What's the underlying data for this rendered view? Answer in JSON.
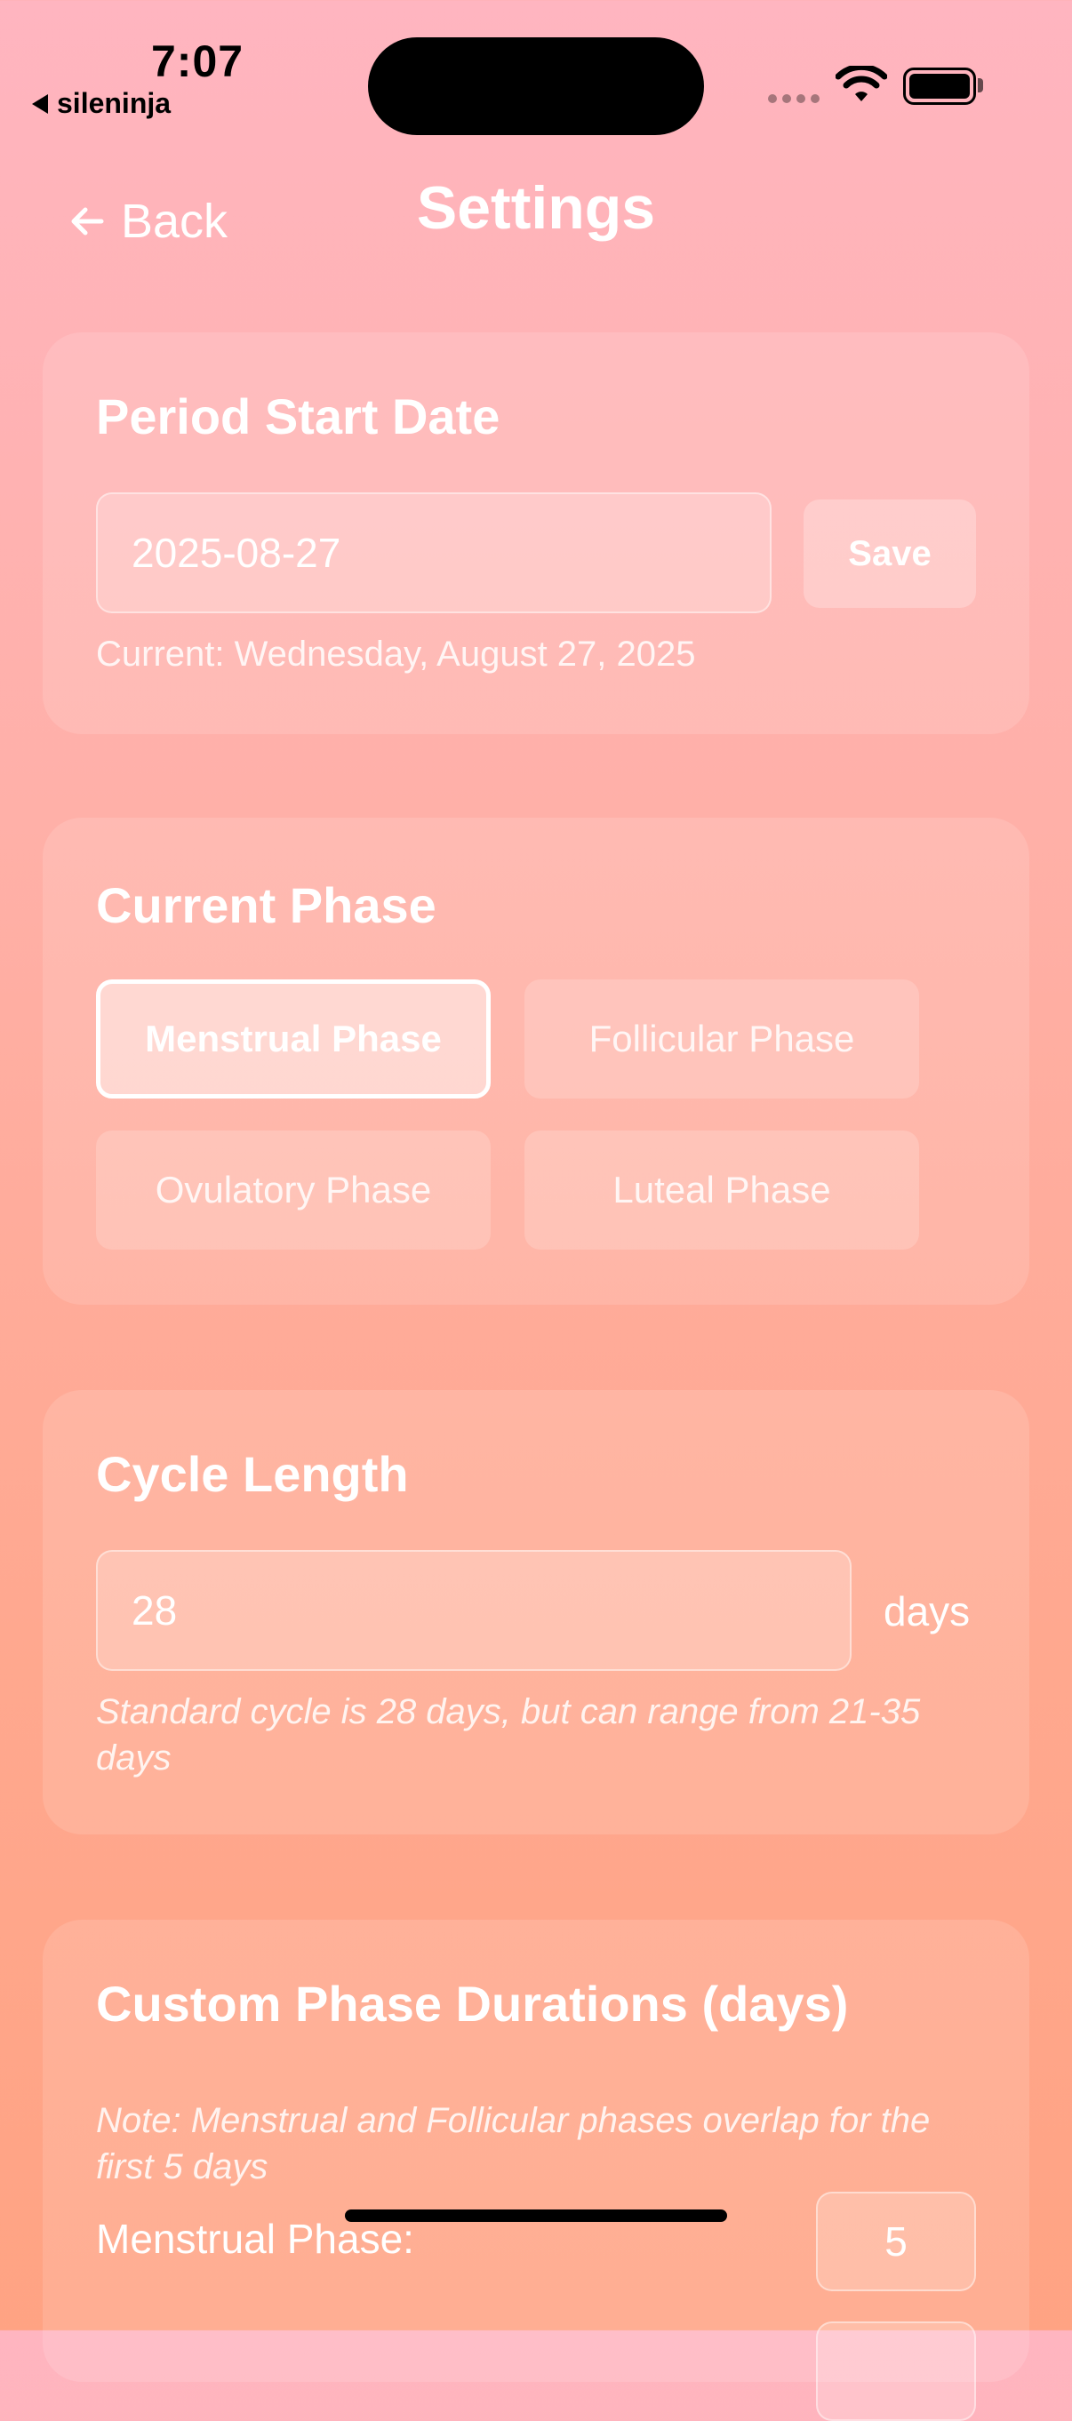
{
  "status_bar": {
    "time": "7:07",
    "back_app": "sileninja"
  },
  "header": {
    "back_label": "Back",
    "title": "Settings"
  },
  "period_start": {
    "title": "Period Start Date",
    "date_value": "2025-08-27",
    "save_label": "Save",
    "current_text": "Current: Wednesday, August 27, 2025"
  },
  "current_phase": {
    "title": "Current Phase",
    "options": [
      "Menstrual Phase",
      "Follicular Phase",
      "Ovulatory Phase",
      "Luteal Phase"
    ],
    "selected": "Menstrual Phase"
  },
  "cycle_length": {
    "title": "Cycle Length",
    "value": "28",
    "units": "days",
    "hint": "Standard cycle is 28 days, but can range from 21-35 days"
  },
  "custom_durations": {
    "title": "Custom Phase Durations (days)",
    "note": "Note: Menstrual and Follicular phases overlap for the first 5 days",
    "rows": [
      {
        "label": "Menstrual Phase:",
        "value": "5"
      }
    ]
  },
  "icons": {
    "back": "arrow-left-icon",
    "wifi": "wifi-icon",
    "battery": "battery-icon"
  }
}
